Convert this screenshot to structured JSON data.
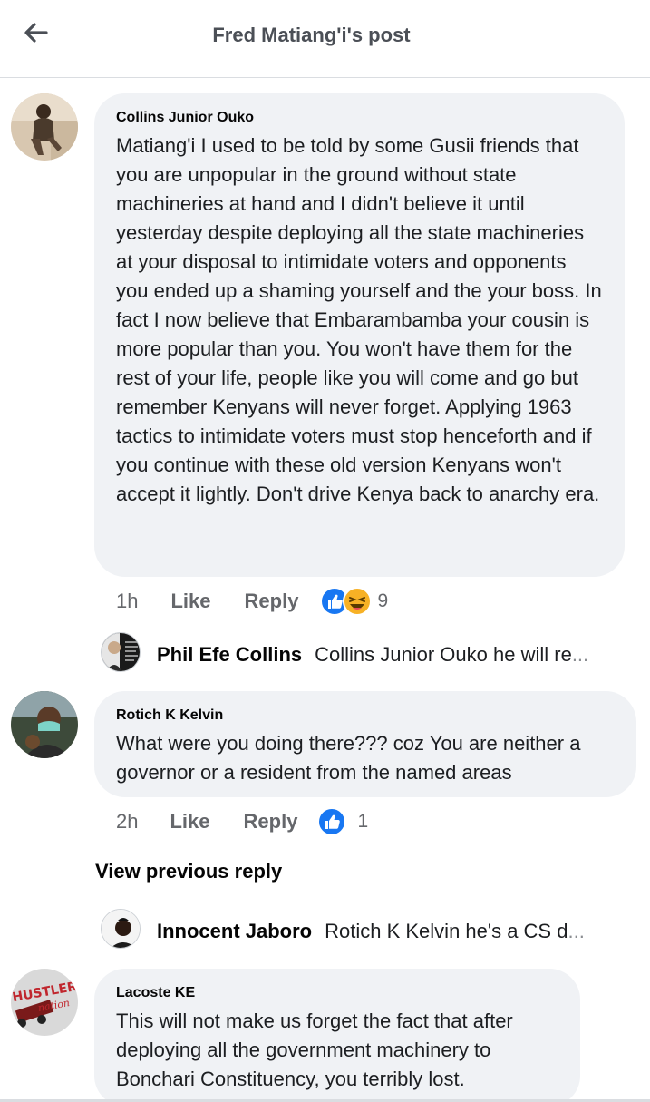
{
  "header": {
    "title": "Fred Matiang'i's post"
  },
  "comments": [
    {
      "author": "Collins Junior Ouko",
      "text": "Matiang'i I used to be told by some Gusii friends that you are unpopular in the ground without state machineries at hand and I didn't believe it until yesterday despite deploying all the state machineries at your disposal to intimidate voters and opponents you ended up a shaming yourself and the your boss. In fact I now believe that Embarambamba your cousin is more popular than you. You won't have them for the rest of your life, people like you will come and go but remember Kenyans will never forget. Applying 1963 tactics to intimidate voters must stop henceforth and if you continue with these old version Kenyans won't accept it lightly. Don't drive Kenya back to anarchy era.",
      "time": "1h",
      "like_label": "Like",
      "reply_label": "Reply",
      "reaction_count": "9",
      "reply_preview": {
        "author": "Phil Efe Collins",
        "text": "Collins Junior Ouko he will re",
        "ellipsis": "..."
      }
    },
    {
      "author": "Rotich K Kelvin",
      "text": "What were you doing there??? coz You are neither a governor or a resident from the named areas",
      "time": "2h",
      "like_label": "Like",
      "reply_label": "Reply",
      "reaction_count": "1",
      "view_previous": "View previous reply",
      "reply_preview": {
        "author": "Innocent Jaboro",
        "text": "Rotich K Kelvin he's a CS d",
        "ellipsis": "..."
      }
    },
    {
      "author": "Lacoste KE",
      "text": "This will not make us forget the fact that after deploying all the government machinery to Bonchari Constituency, you terribly lost."
    }
  ],
  "avatar_labels": {
    "lacoste_logo_line1": "HUSTLER",
    "lacoste_logo_line2": "nation"
  },
  "colors": {
    "bubble": "#f0f2f5",
    "like_blue": "#1877f2",
    "haha_yellow": "#f7b125",
    "secondary_text": "#65676b"
  }
}
